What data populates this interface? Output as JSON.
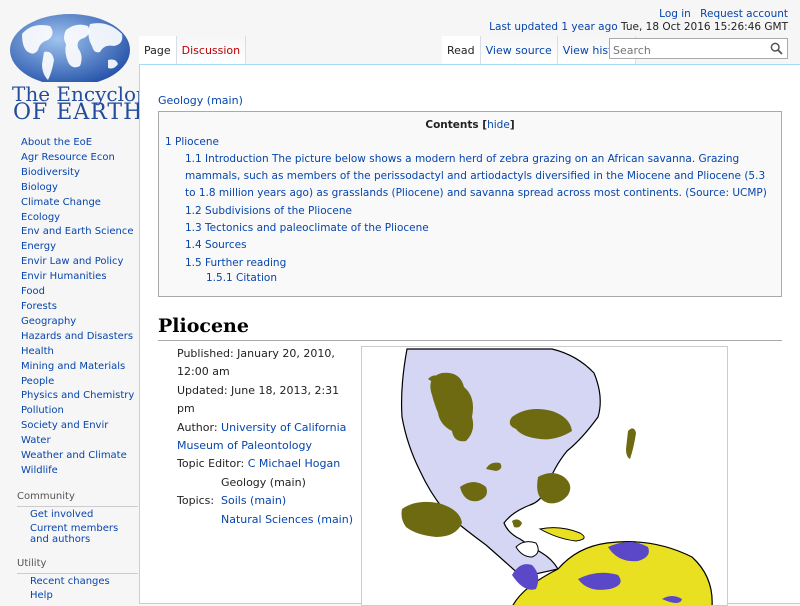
{
  "user": {
    "login": "Log in",
    "request_account": "Request account"
  },
  "updated": {
    "prefix": "Last updated",
    "ago": "1 year ago",
    "date": "Tue, 18 Oct 2016 15:26:46 GMT"
  },
  "logo": {
    "line1": "The Encyclopedia",
    "line2": "OF EARTH"
  },
  "sidebar": {
    "items": [
      "About the EoE",
      "Agr Resource Econ",
      "Biodiversity",
      "Biology",
      "Climate Change",
      "Ecology",
      "Env and Earth Science",
      "Energy",
      "Envir Law and Policy",
      "Envir Humanities",
      "Food",
      "Forests",
      "Geography",
      "Hazards and Disasters",
      "Health",
      "Mining and Materials",
      "People",
      "Physics and Chemistry",
      "Pollution",
      "Society and Envir",
      "Water",
      "Weather and Climate",
      "Wildlife"
    ],
    "community_title": "Community",
    "community": [
      "Get involved",
      "Current members and authors"
    ],
    "utility_title": "Utility",
    "utility": [
      "Recent changes",
      "Help"
    ]
  },
  "tabs": {
    "page": "Page",
    "discussion": "Discussion",
    "read": "Read",
    "view_source": "View source",
    "view_history": "View history"
  },
  "search": {
    "placeholder": "Search"
  },
  "breadcrumb": "Geology (main)",
  "toc": {
    "title": "Contents",
    "hide": "hide",
    "s1": "1 Pliocene",
    "s1_1": "1.1 Introduction The picture below shows a modern herd of zebra grazing on an African savanna. Grazing mammals, such as members of the perissodactyl and artiodactyls diversified in the Miocene and Pliocene (5.3 to 1.8 million years ago) as grasslands (Pliocene) and savanna spread across most continents. (Source: UCMP)",
    "s1_2": "1.2 Subdivisions of the Pliocene",
    "s1_3": "1.3 Tectonics and paleoclimate of the Pliocene",
    "s1_4": "1.4 Sources",
    "s1_5": "1.5 Further reading",
    "s1_5_1": "1.5.1 Citation"
  },
  "article": {
    "title": "Pliocene",
    "published_label": "Published:",
    "published_value": "January 20, 2010, 12:00 am",
    "updated_label": "Updated:",
    "updated_value": "June 18, 2013, 2:31 pm",
    "author_label": "Author:",
    "author_value": "University of California Museum of Paleontology",
    "editor_label": "Topic Editor:",
    "editor_value": "C Michael Hogan",
    "topics_label": "Topics:",
    "topics": [
      "Geology (main)",
      "Soils (main)",
      "Natural Sciences (main)"
    ]
  },
  "colors": {
    "link": "#0645ad",
    "new_link": "#ba0000",
    "map_land_north": "#d4d6f4",
    "map_land_south": "#e8e020",
    "map_fauna_north": "#6e6a12",
    "map_fauna_south": "#5a48c8"
  }
}
